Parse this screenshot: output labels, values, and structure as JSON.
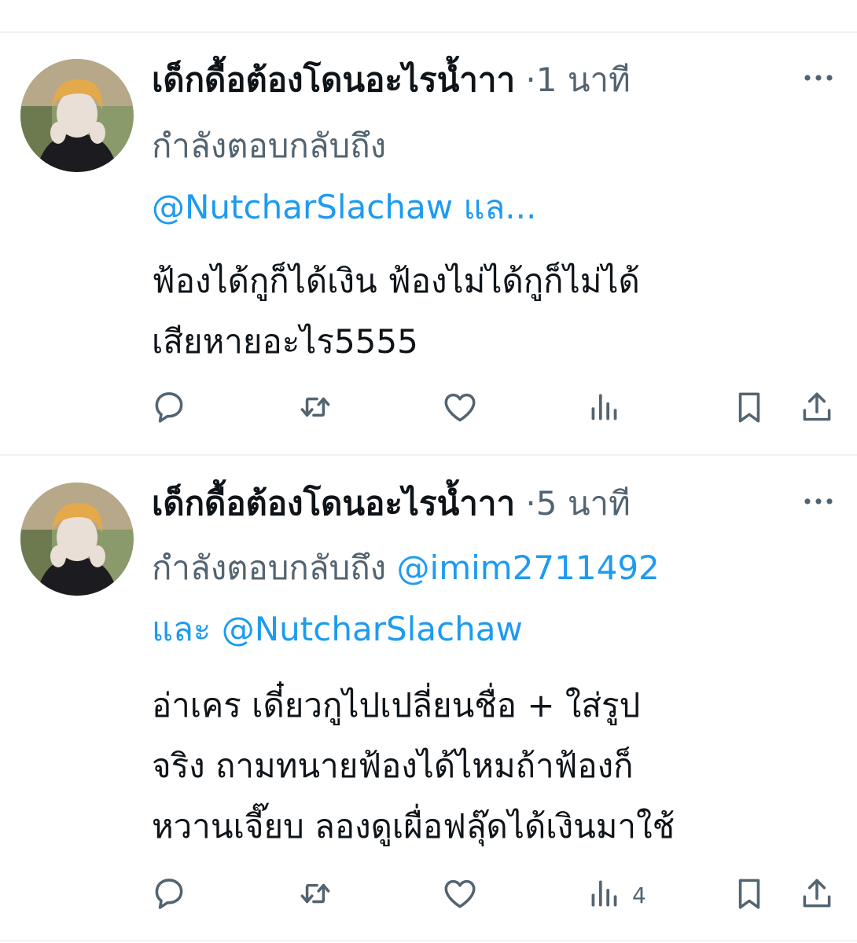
{
  "tweets": [
    {
      "display_name": "เด็กดื้อต้องโดนอะไรน้ำาา",
      "dot": "·",
      "time": "1 นาที",
      "reply_prefix": "กำลังตอบกลับถึง",
      "reply_line2_link": "@NutcharSlachaw แล...",
      "text_lines": [
        "ฟ้องได้กูก็ได้เงิน ฟ้องไม่ได้กูก็ไม่ได้",
        "เสียหายอะไร5555"
      ],
      "views_count": ""
    },
    {
      "display_name": "เด็กดื้อต้องโดนอะไรน้ำาา",
      "dot": "·",
      "time": "5 นาที",
      "reply_prefix": "กำลังตอบกลับถึง",
      "reply_link1": "@imim2711492",
      "reply_and": "และ",
      "reply_link2": "@NutcharSlachaw",
      "text_lines": [
        "อ่าเคร เดี๋ยวกูไปเปลี่ยนชื่อ + ใส่รูป",
        "จริง ถามทนายฟ้องได้ไหมถ้าฟ้องก็",
        "หวานเจี๊ยบ ลองดูเผื่อฟลุ๊ดได้เงินมาใช้"
      ],
      "views_count": "4"
    }
  ],
  "colors": {
    "text": "#0f1419",
    "secondary": "#536471",
    "link": "#1d9bf0",
    "divider": "#eff3f4"
  },
  "icons": [
    "reply-icon",
    "retweet-icon",
    "like-icon",
    "views-icon",
    "bookmark-icon",
    "share-icon",
    "more-icon"
  ]
}
